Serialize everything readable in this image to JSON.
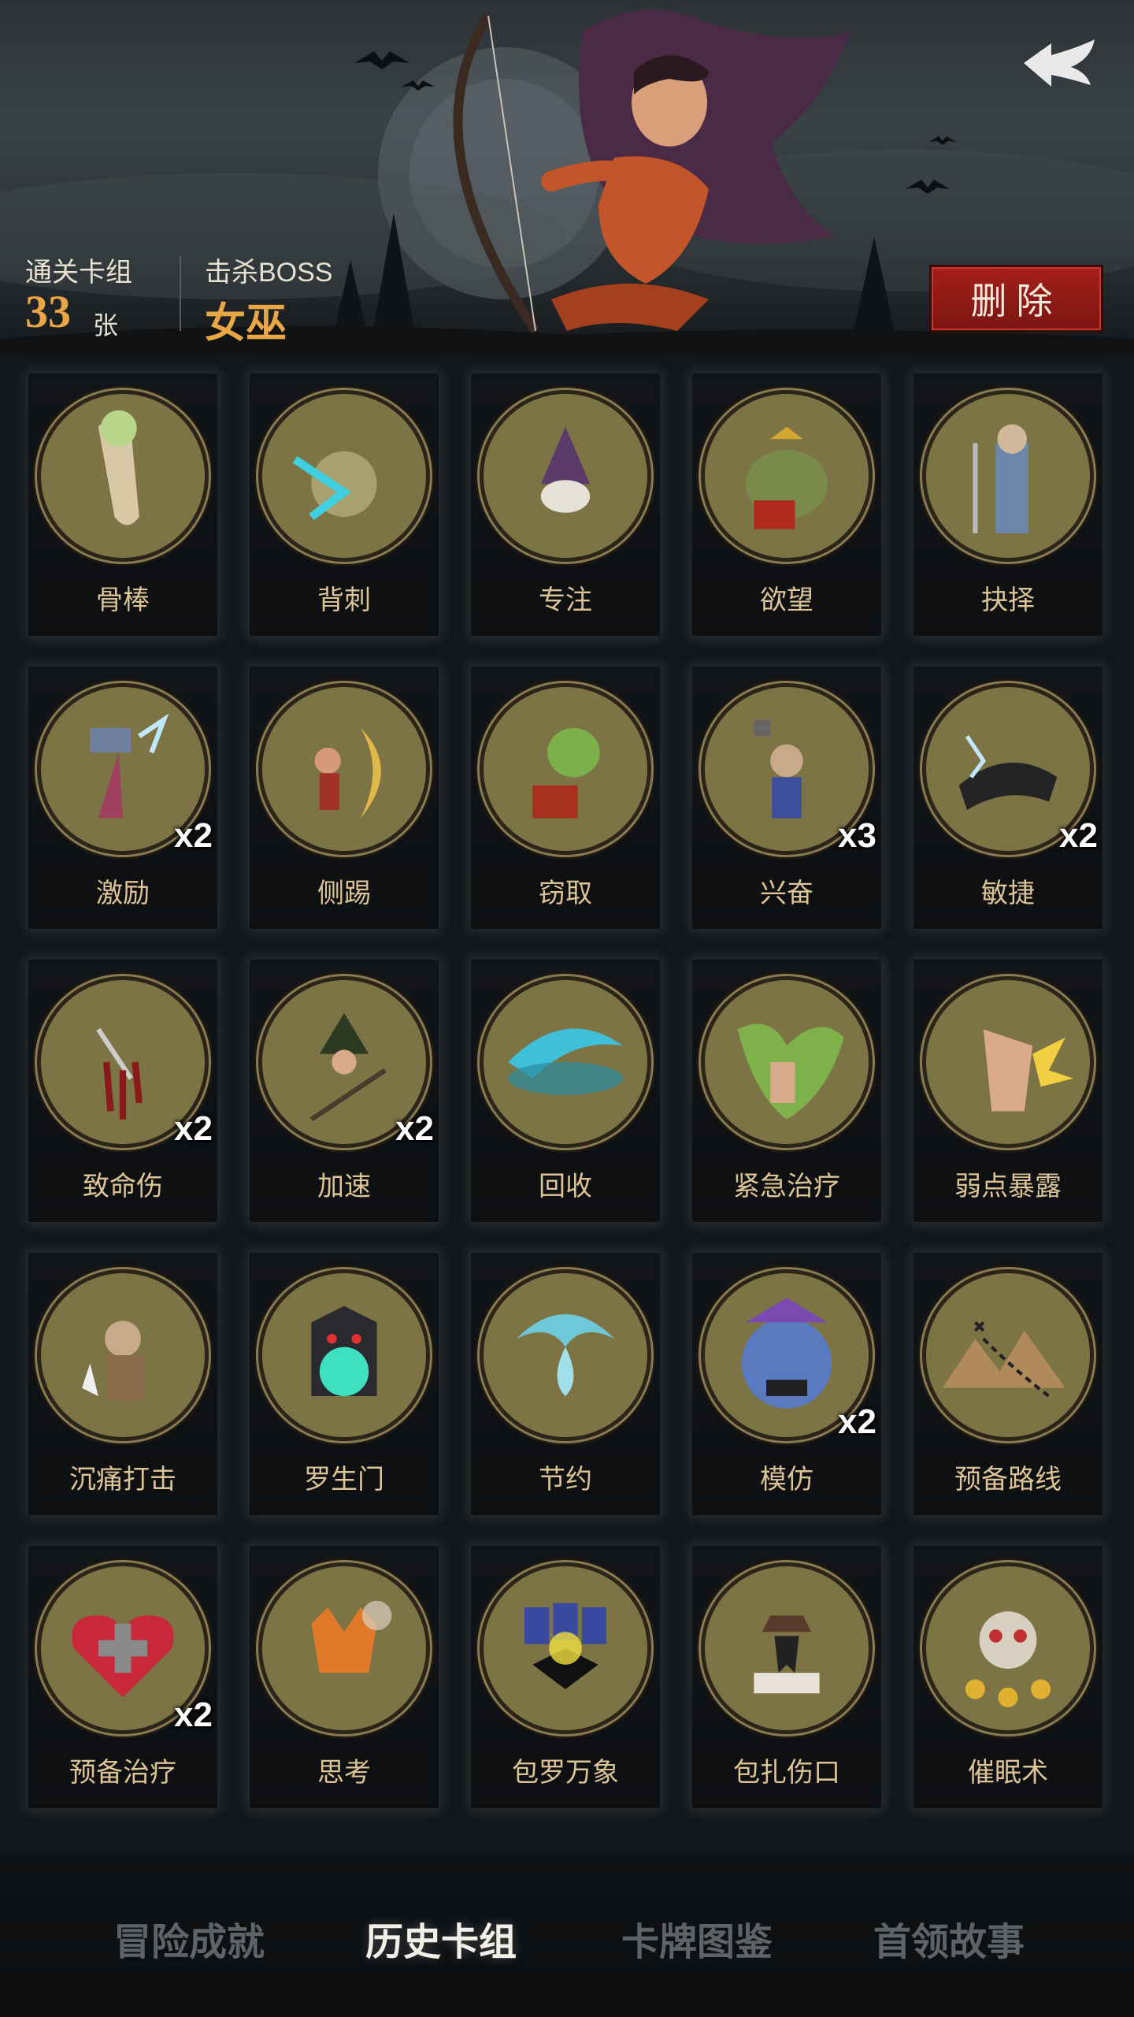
{
  "header": {
    "deck_label": "通关卡组",
    "deck_count": "33",
    "deck_unit": "张",
    "boss_label": "击杀BOSS",
    "boss_name": "女巫",
    "delete_label": "删除",
    "back_icon": "back-arrow-icon"
  },
  "cards": [
    {
      "name": "骨棒",
      "count": "",
      "icon": "bone-club-icon"
    },
    {
      "name": "背刺",
      "count": "",
      "icon": "backstab-icon"
    },
    {
      "name": "专注",
      "count": "",
      "icon": "wizard-focus-icon"
    },
    {
      "name": "欲望",
      "count": "",
      "icon": "greed-frog-icon"
    },
    {
      "name": "抉择",
      "count": "",
      "icon": "sage-choice-icon"
    },
    {
      "name": "激励",
      "count": "x2",
      "icon": "hammer-inspire-icon"
    },
    {
      "name": "侧踢",
      "count": "",
      "icon": "side-kick-icon"
    },
    {
      "name": "窃取",
      "count": "",
      "icon": "goblin-steal-icon"
    },
    {
      "name": "兴奋",
      "count": "x3",
      "icon": "excited-dwarf-icon"
    },
    {
      "name": "敏捷",
      "count": "x2",
      "icon": "panther-agility-icon"
    },
    {
      "name": "致命伤",
      "count": "x2",
      "icon": "lethal-wound-icon"
    },
    {
      "name": "加速",
      "count": "x2",
      "icon": "witch-haste-icon"
    },
    {
      "name": "回收",
      "count": "",
      "icon": "recycle-swirl-icon"
    },
    {
      "name": "紧急治疗",
      "count": "",
      "icon": "emergency-heal-icon"
    },
    {
      "name": "弱点暴露",
      "count": "",
      "icon": "weak-point-icon"
    },
    {
      "name": "沉痛打击",
      "count": "",
      "icon": "heavy-strike-icon"
    },
    {
      "name": "罗生门",
      "count": "",
      "icon": "demon-gate-icon"
    },
    {
      "name": "节约",
      "count": "",
      "icon": "water-drop-icon"
    },
    {
      "name": "模仿",
      "count": "x2",
      "icon": "troll-mimic-icon"
    },
    {
      "name": "预备路线",
      "count": "",
      "icon": "map-route-icon"
    },
    {
      "name": "预备治疗",
      "count": "x2",
      "icon": "heart-heal-icon"
    },
    {
      "name": "思考",
      "count": "",
      "icon": "fox-think-icon"
    },
    {
      "name": "包罗万象",
      "count": "",
      "icon": "all-cards-icon"
    },
    {
      "name": "包扎伤口",
      "count": "",
      "icon": "plague-doctor-icon"
    },
    {
      "name": "催眠术",
      "count": "",
      "icon": "hypnosis-monkey-icon"
    }
  ],
  "tabs": [
    {
      "label": "冒险成就",
      "active": false
    },
    {
      "label": "历史卡组",
      "active": true
    },
    {
      "label": "卡牌图鉴",
      "active": false
    },
    {
      "label": "首领故事",
      "active": false
    }
  ],
  "colors": {
    "accent_gold": "#e9a646",
    "delete_red": "#a41f1a",
    "medal_bg": "#7d7445",
    "label_tan": "#dcc497"
  }
}
